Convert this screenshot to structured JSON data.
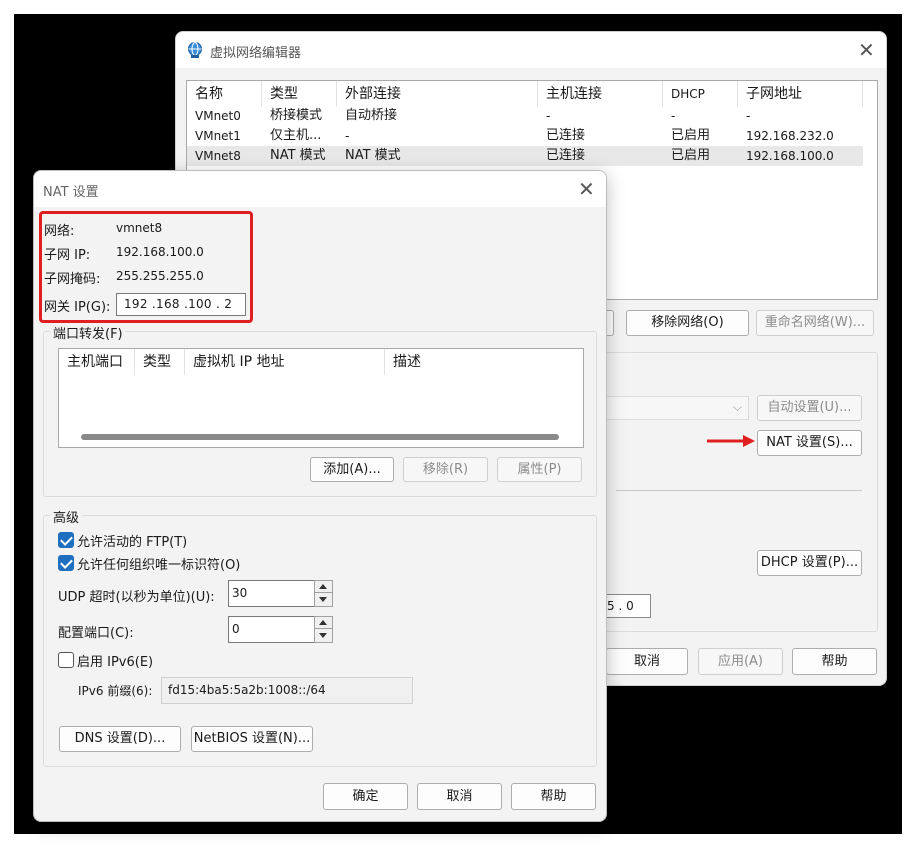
{
  "vne": {
    "title": "虚拟网络编辑器",
    "table": {
      "headers": [
        "名称",
        "类型",
        "外部连接",
        "主机连接",
        "DHCP",
        "子网地址"
      ],
      "rows": [
        [
          "VMnet0",
          "桥接模式",
          "自动桥接",
          "-",
          "-",
          "-"
        ],
        [
          "VMnet1",
          "仅主机...",
          "-",
          "已连接",
          "已启用",
          "192.168.232.0"
        ],
        [
          "VMnet8",
          "NAT 模式",
          "NAT 模式",
          "已连接",
          "已启用",
          "192.168.100.0"
        ]
      ]
    },
    "remove_network_label": "移除网络(O)",
    "rename_network_label": "重命名网络(W)...",
    "auto_settings_label": "自动设置(U)...",
    "nat_settings_label": "NAT 设置(S)...",
    "dhcp_settings_label": "DHCP 设置(P)...",
    "mask_tail": "5 . 0",
    "cancel_label": "取消",
    "apply_label": "应用(A)",
    "help_label": "帮助",
    "arrow_color": "#e02020"
  },
  "nat": {
    "title": "NAT 设置",
    "network_label": "网络:",
    "network_value": "vmnet8",
    "subnet_ip_label": "子网 IP:",
    "subnet_ip_value": "192.168.100.0",
    "subnet_mask_label": "子网掩码:",
    "subnet_mask_value": "255.255.255.0",
    "gateway_label": "网关 IP(G):",
    "gateway_value": "192 .168 .100 .  2",
    "port_forward": {
      "label": "端口转发(F)",
      "headers": [
        "主机端口",
        "类型",
        "虚拟机 IP 地址",
        "描述"
      ],
      "add_label": "添加(A)...",
      "remove_label": "移除(R)",
      "props_label": "属性(P)"
    },
    "advanced": {
      "label": "高级",
      "allow_ftp_label": "允许活动的 FTP(T)",
      "allow_ftp_checked": true,
      "allow_uid_label": "允许任何组织唯一标识符(O)",
      "allow_uid_checked": true,
      "udp_timeout_label": "UDP 超时(以秒为单位)(U):",
      "udp_timeout_value": "30",
      "config_port_label": "配置端口(C):",
      "config_port_value": "0",
      "enable_ipv6_label": "启用 IPv6(E)",
      "enable_ipv6_checked": false,
      "ipv6_prefix_label": "IPv6 前缀(6):",
      "ipv6_prefix_value": "fd15:4ba5:5a2b:1008::/64",
      "dns_label": "DNS 设置(D)...",
      "netbios_label": "NetBIOS 设置(N)..."
    },
    "ok_label": "确定",
    "cancel_label": "取消",
    "help_label": "帮助",
    "highlight_color": "#e02020"
  }
}
